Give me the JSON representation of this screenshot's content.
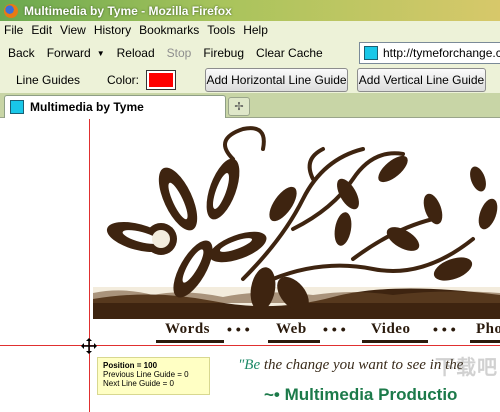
{
  "window": {
    "title": "Multimedia by Tyme - Mozilla Firefox"
  },
  "menu": [
    "File",
    "Edit",
    "View",
    "History",
    "Bookmarks",
    "Tools",
    "Help"
  ],
  "toolbar": {
    "back": "Back",
    "forward": "Forward",
    "reload": "Reload",
    "stop": "Stop",
    "firebug": "Firebug",
    "clear_cache": "Clear Cache",
    "url": "http://tymeforchange.c"
  },
  "guides_bar": {
    "line_guides_label": "Line Guides",
    "color_label": "Color:",
    "color_value": "#ff0000",
    "add_horizontal": "Add Horizontal Line Guide",
    "add_vertical": "Add Vertical Line Guide"
  },
  "tabs": [
    {
      "title": "Multimedia by Tyme"
    }
  ],
  "page": {
    "nav": [
      "Words",
      "Web",
      "Video",
      "Pho"
    ],
    "tagline_be": "\"Be",
    "tagline_rest": " the change you want to see in the",
    "brand": "~• Multimedia Productio"
  },
  "tooltip": {
    "position": "Position = 100",
    "previous": "Previous Line Guide = 0",
    "next": "Next Line Guide = 0"
  },
  "watermark": "下载吧",
  "colors": {
    "guide": "#e03030",
    "brand_green": "#1c7a4a",
    "banner_brown": "#3e2410"
  }
}
